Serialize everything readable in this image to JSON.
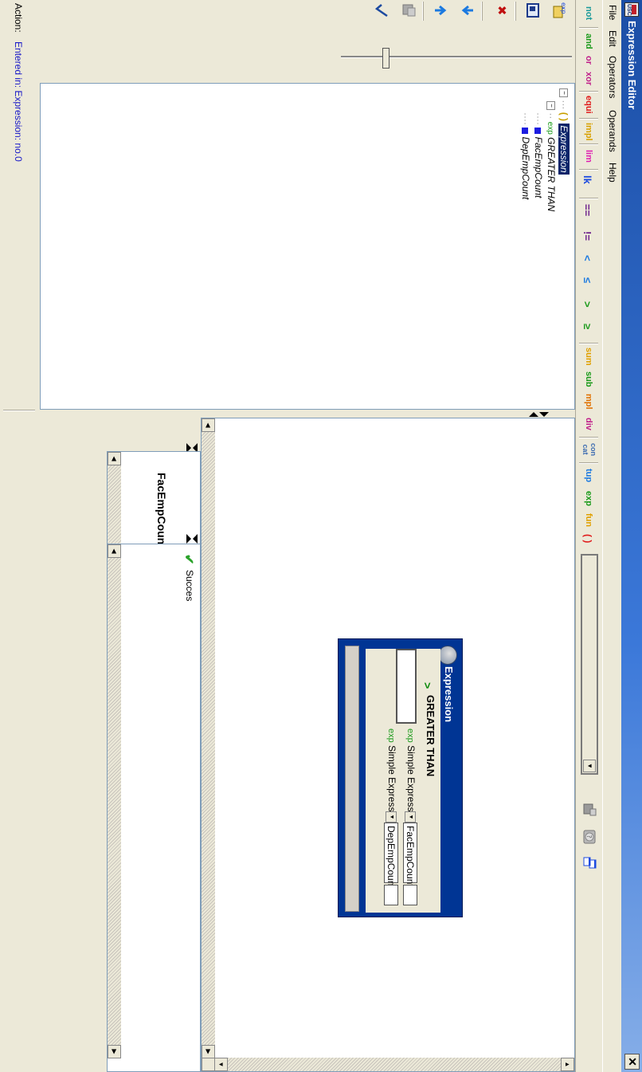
{
  "window": {
    "title": "Expression Editor",
    "logo_text": "USC",
    "close_glyph": "✕"
  },
  "menu": {
    "file": "File",
    "edit": "Edit",
    "operators": "Operators",
    "operands": "Operands",
    "help": "Help"
  },
  "toolbar": {
    "not": "not",
    "and": "and",
    "or": "or",
    "xor": "xor",
    "equi": "equi",
    "impl": "impl",
    "lim": "lim",
    "lk": "lk",
    "eq": "==",
    "neq": "!=",
    "lt": "<",
    "le": "≤",
    "gt": ">",
    "ge": "≥",
    "sum": "sum",
    "sub": "sub",
    "mpl": "mpl",
    "div": "div",
    "concat_top": "con",
    "concat_bottom": "cat",
    "tup": "tup",
    "exp": "exp",
    "fun": "fun",
    "paren": "( )",
    "combo_value": ""
  },
  "sidebar": {
    "exp_icon_text": "exp",
    "delete_glyph": "✖"
  },
  "tree": {
    "root": "Expression",
    "operator_prefix": "exp",
    "operator": "GREATER THAN",
    "child1": "FacEmpCount",
    "child2": "DepEmpCount"
  },
  "expression_window": {
    "title": "Expression",
    "operator_symbol": ">",
    "operator_name": "GREATER THAN",
    "rows": [
      {
        "prefix": "exp",
        "kind": "Simple Expression",
        "value": "FacEmpCount"
      },
      {
        "prefix": "exp",
        "kind": "Simple Expression",
        "value": "DepEmpCount"
      }
    ]
  },
  "result": {
    "expression_text": "FacEmpCount > DepEmpCount"
  },
  "validation": {
    "text": "Succes"
  },
  "status": {
    "label": "Action:",
    "message": "Entered in: Expression: no.0"
  },
  "colors": {
    "title_bar": "#1b4ea6",
    "selection": "#0a246a",
    "expr_window": "#003594",
    "status_text": "#1818c8",
    "check": "#2aa22a"
  }
}
